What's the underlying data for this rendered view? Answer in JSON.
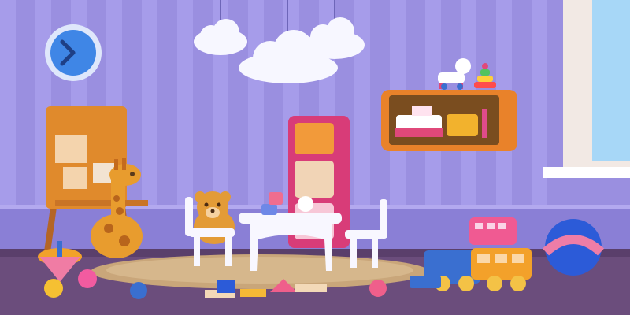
{
  "scene": {
    "subject": "children-playroom-illustration",
    "colors": {
      "wall": "#9a8fe0",
      "wall_stripe": "#a69cea",
      "floor": "#6b4d7c",
      "floor_dark": "#5a3f6b",
      "rug": "#c9a67a",
      "wood": "#e08a2c",
      "white": "#ffffff",
      "pink": "#e0487a",
      "blue": "#3a6fd0",
      "window_sky": "#a7d7f7"
    },
    "objects": [
      {
        "name": "wall-clock",
        "icon": "clock-icon"
      },
      {
        "name": "cloud-decorations",
        "icon": "cloud-icon"
      },
      {
        "name": "drawing-easel",
        "icon": "easel-icon"
      },
      {
        "name": "toy-giraffe",
        "icon": "giraffe-icon"
      },
      {
        "name": "teddy-bear",
        "icon": "teddy-bear-icon"
      },
      {
        "name": "kids-table",
        "icon": "table-icon"
      },
      {
        "name": "kids-chairs",
        "icon": "chair-icon"
      },
      {
        "name": "wardrobe-cabinet",
        "icon": "cabinet-icon"
      },
      {
        "name": "wall-shelf-with-toys",
        "icon": "shelf-icon"
      },
      {
        "name": "toy-horse",
        "icon": "rocking-horse-icon"
      },
      {
        "name": "stacking-rings",
        "icon": "stacking-toy-icon"
      },
      {
        "name": "window",
        "icon": "window-icon"
      },
      {
        "name": "toy-train",
        "icon": "train-icon"
      },
      {
        "name": "toy-bus",
        "icon": "bus-icon"
      },
      {
        "name": "ball",
        "icon": "ball-icon"
      },
      {
        "name": "spinning-top",
        "icon": "spinning-top-icon"
      },
      {
        "name": "building-blocks",
        "icon": "blocks-icon"
      }
    ]
  }
}
